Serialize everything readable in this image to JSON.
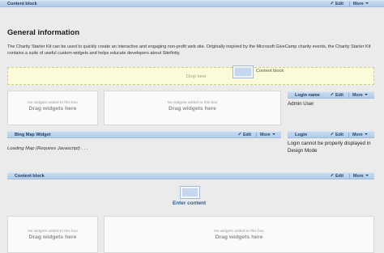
{
  "widget_toolbar": {
    "edit_label": "Edit",
    "more_label": "More"
  },
  "content_block_top": {
    "title": "Content block"
  },
  "general": {
    "title": "General information",
    "text": "The Charity Starter Kit can be used to quickly create an interactive and engaging non-profit web site. Originally inspired by the Microsoft GiveCamp charity events, the Charity Starter Kit contains a suite of useful custom widgets and helps educate developers about Sitefinity."
  },
  "drop_zone": {
    "label": "Drop here",
    "dragging_widget": "Content block"
  },
  "empty_zone": {
    "hint": "No widgets added to this box",
    "drag": "Drag widgets here"
  },
  "login_name": {
    "title": "Login name",
    "value": "Admin User"
  },
  "bing_map": {
    "title": "Bing Map Widget",
    "status": "Loading Map (Requires Javascript) . . ."
  },
  "login": {
    "title": "Login",
    "message": "Login cannot be properly displayed in Design Mode"
  },
  "content_block_bottom": {
    "title": "Content block",
    "action": "Enter content"
  }
}
